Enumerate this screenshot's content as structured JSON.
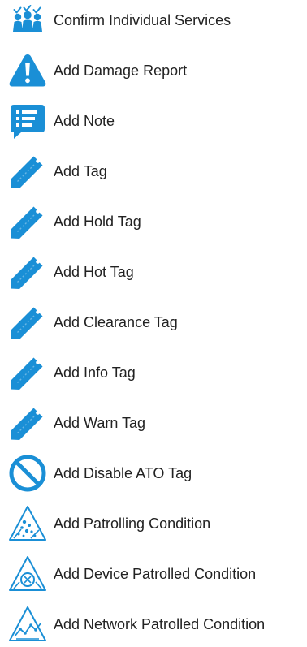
{
  "colors": {
    "icon_blue": "#1a8fd6",
    "text": "#222222"
  },
  "menu": {
    "items": [
      {
        "label": "Confirm Individual Services",
        "icon": "people-group-icon"
      },
      {
        "label": "Add Damage Report",
        "icon": "warning-triangle-icon"
      },
      {
        "label": "Add Note",
        "icon": "note-speech-bubble-icon"
      },
      {
        "label": "Add Tag",
        "icon": "tag-icon"
      },
      {
        "label": "Add Hold Tag",
        "icon": "tag-icon"
      },
      {
        "label": "Add Hot Tag",
        "icon": "tag-icon"
      },
      {
        "label": "Add Clearance Tag",
        "icon": "tag-icon"
      },
      {
        "label": "Add Info Tag",
        "icon": "tag-icon"
      },
      {
        "label": "Add Warn Tag",
        "icon": "tag-icon"
      },
      {
        "label": "Add Disable ATO Tag",
        "icon": "prohibited-circle-icon"
      },
      {
        "label": "Add Patrolling Condition",
        "icon": "patrolling-triangle-icon"
      },
      {
        "label": "Add Device Patrolled Condition",
        "icon": "device-patrolled-triangle-icon"
      },
      {
        "label": "Add Network Patrolled Condition",
        "icon": "network-patrolled-triangle-icon"
      }
    ]
  }
}
